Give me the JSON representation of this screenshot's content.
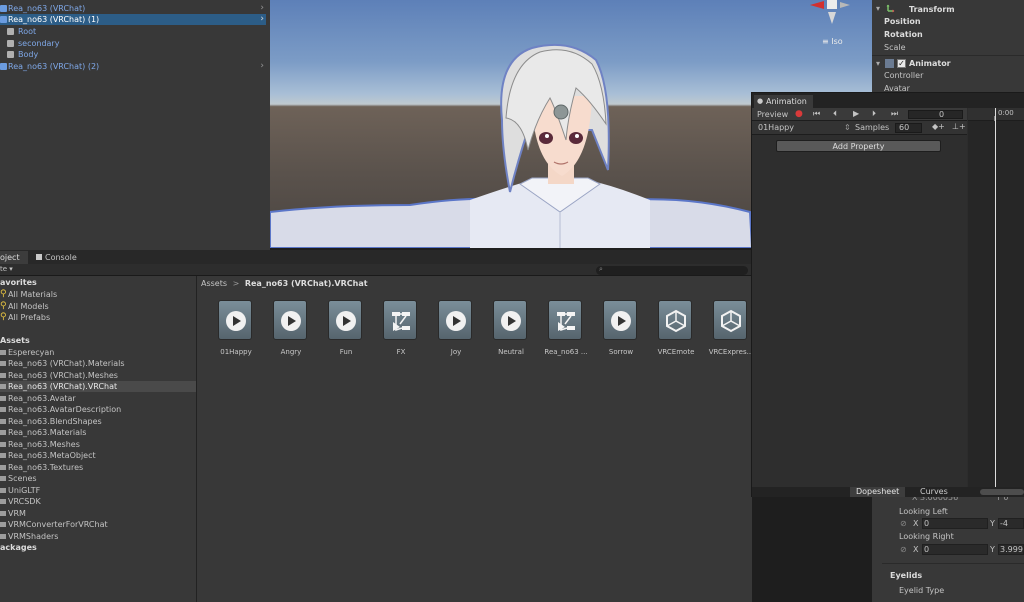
{
  "hierarchy": {
    "rows": [
      {
        "label": "Rea_no63 (VRChat)"
      },
      {
        "label": "Rea_no63 (VRChat) (1)"
      },
      {
        "label": "Root"
      },
      {
        "label": "secondary"
      },
      {
        "label": "Body"
      },
      {
        "label": "Rea_no63 (VRChat) (2)"
      }
    ]
  },
  "scene": {
    "projection_label": "≡ Iso"
  },
  "inspector": {
    "transform_title": "Transform",
    "position": "Position",
    "rotation": "Rotation",
    "scale": "Scale",
    "animator_title": "Animator",
    "controller": "Controller",
    "avatar": "Avatar",
    "partial_value": "X 3.000056",
    "partial_value_y": "Y 0",
    "looking_left": "Looking Left",
    "ll_x_label": "X",
    "ll_x": "0",
    "ll_y_label": "Y",
    "ll_y": "-4",
    "looking_right": "Looking Right",
    "lr_x_label": "X",
    "lr_x": "0",
    "lr_y_label": "Y",
    "lr_y": "3.999",
    "eyelids": "Eyelids",
    "eyelid_type": "Eyelid Type"
  },
  "project": {
    "tab_project": "oject",
    "tab_console": "Console",
    "create_label": "te ▾",
    "favorites_header": "avorites",
    "favorites": [
      "All Materials",
      "All Models",
      "All Prefabs"
    ],
    "assets_header": "Assets",
    "folders": [
      "Esperecyan",
      "Rea_no63 (VRChat).Materials",
      "Rea_no63 (VRChat).Meshes",
      "Rea_no63 (VRChat).VRChat",
      "Rea_no63.Avatar",
      "Rea_no63.AvatarDescription",
      "Rea_no63.BlendShapes",
      "Rea_no63.Materials",
      "Rea_no63.Meshes",
      "Rea_no63.MetaObject",
      "Rea_no63.Textures",
      "Scenes",
      "UniGLTF",
      "VRCSDK",
      "VRM",
      "VRMConverterForVRChat",
      "VRMShaders"
    ],
    "packages_header": "ackages",
    "breadcrumb_root": "Assets",
    "breadcrumb_sep": ">",
    "breadcrumb_current": "Rea_no63 (VRChat).VRChat",
    "assets": [
      {
        "label": "01Happy",
        "icon": "animation-clip-icon"
      },
      {
        "label": "Angry",
        "icon": "animation-clip-icon"
      },
      {
        "label": "Fun",
        "icon": "animation-clip-icon"
      },
      {
        "label": "FX",
        "icon": "animator-controller-icon"
      },
      {
        "label": "Joy",
        "icon": "animation-clip-icon"
      },
      {
        "label": "Neutral",
        "icon": "animation-clip-icon"
      },
      {
        "label": "Rea_no63 ...",
        "icon": "animator-controller-icon"
      },
      {
        "label": "Sorrow",
        "icon": "animation-clip-icon"
      },
      {
        "label": "VRCEmote",
        "icon": "unity-asset-icon"
      },
      {
        "label": "VRCExpres...",
        "icon": "unity-asset-icon"
      }
    ]
  },
  "animation": {
    "tab_label": "Animation",
    "preview_label": "Preview",
    "frame_value": "0",
    "time_label": "0:00",
    "clip_name": "01Happy",
    "samples_label": "Samples",
    "samples_value": "60",
    "add_property": "Add Property",
    "dopesheet": "Dopesheet",
    "curves": "Curves"
  }
}
